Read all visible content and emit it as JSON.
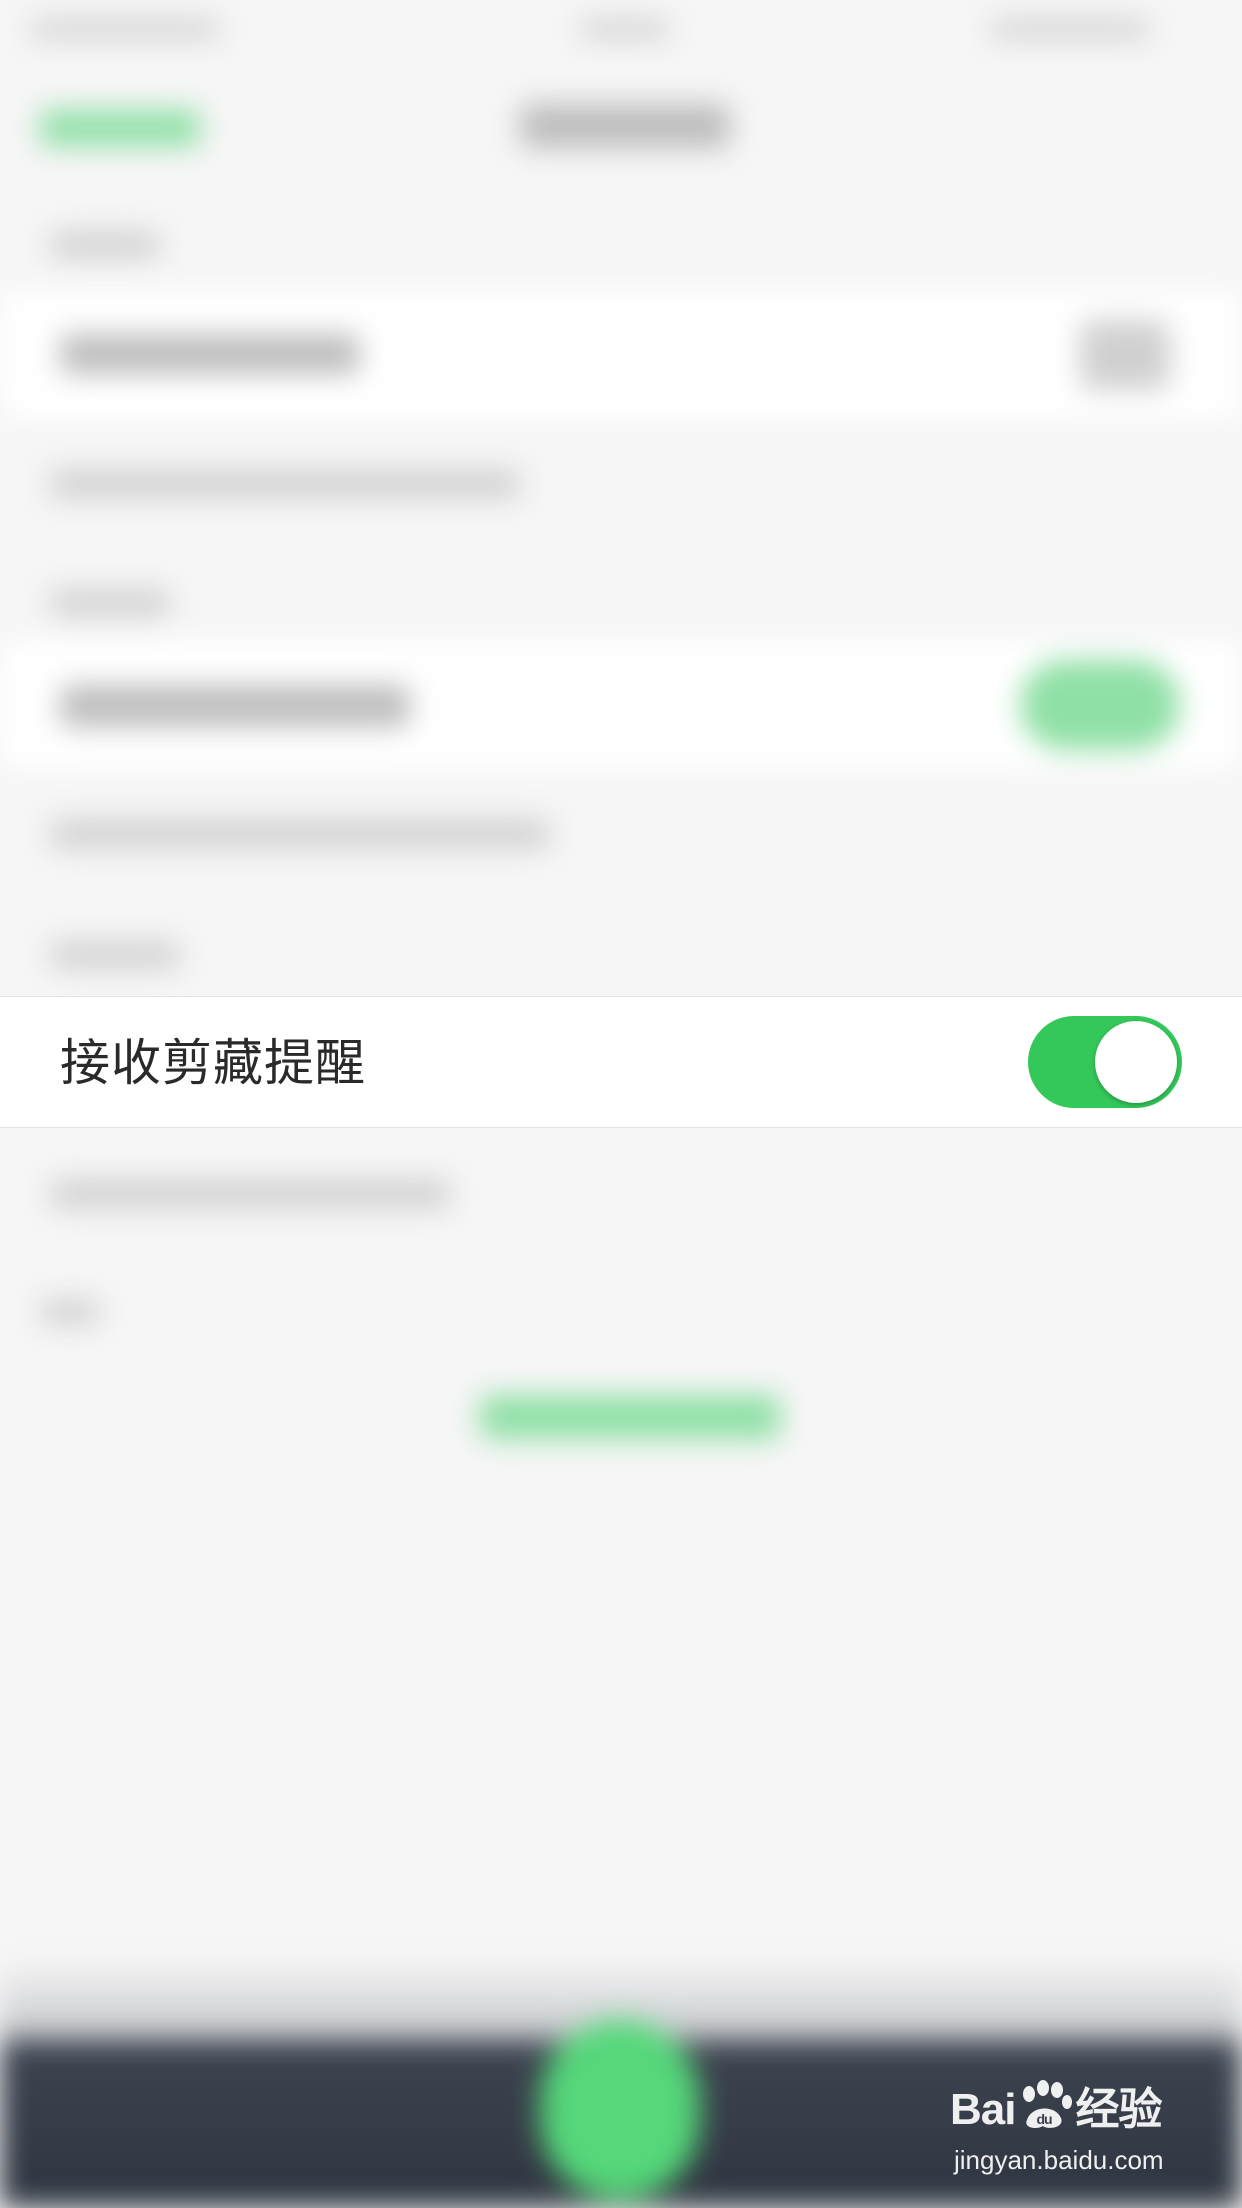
{
  "settings": {
    "receive_clip_reminder": {
      "label": "接收剪藏提醒",
      "enabled": true
    }
  },
  "colors": {
    "toggle_on": "#34c759",
    "background": "#f6f6f6",
    "bottom_bar": "#2f3540",
    "fab": "#55d77a"
  },
  "watermark": {
    "logo_text_left": "Bai",
    "logo_text_right": "经验",
    "url": "jingyan.baidu.com"
  }
}
